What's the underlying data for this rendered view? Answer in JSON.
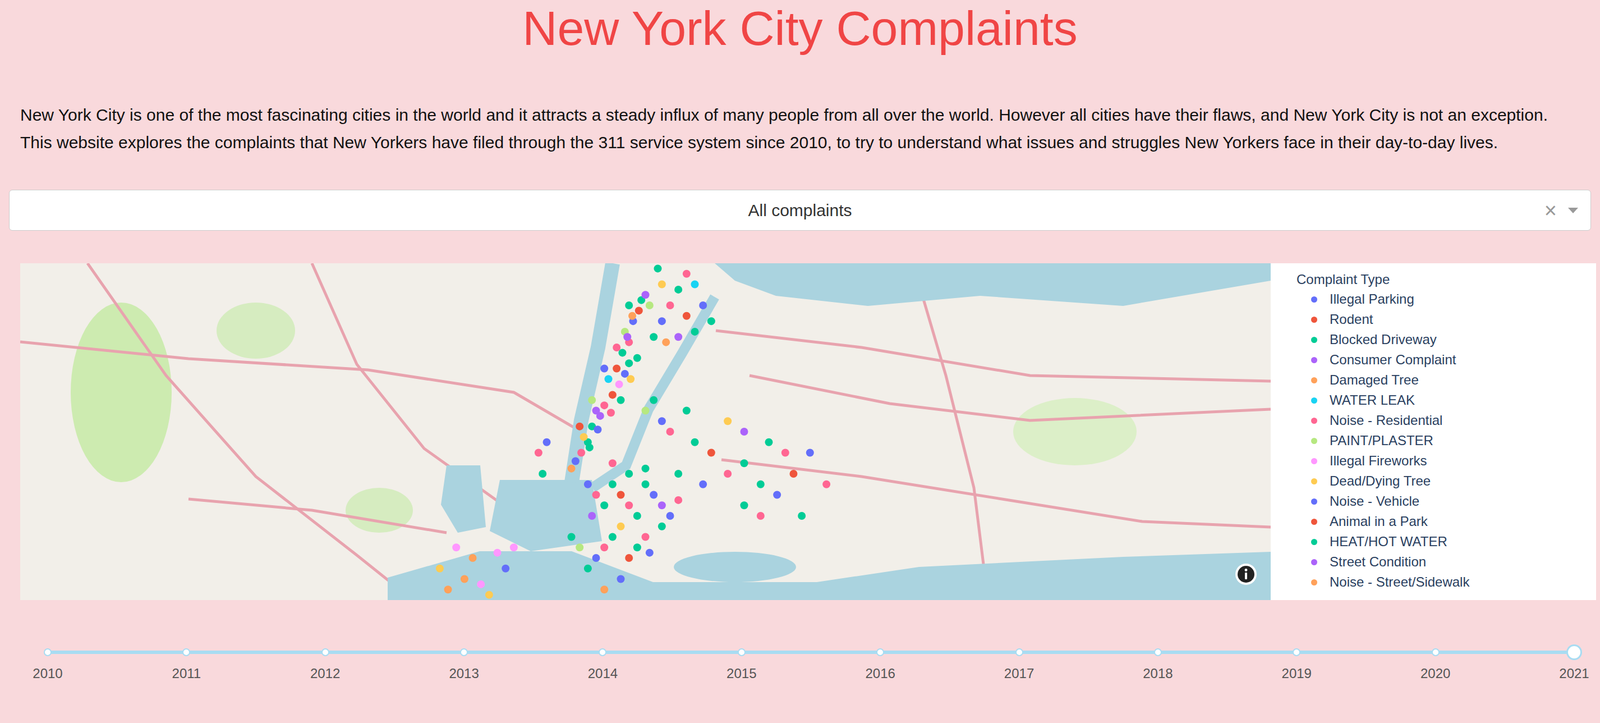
{
  "title": "New York City Complaints",
  "intro": [
    "New York City is one of the most fascinating cities in the world and it attracts a steady influx of many people from all over the world. However all cities have their flaws, and New York City is not an exception.",
    "This website explores the complaints that New Yorkers have filed through the 311 service system since 2010, to try to understand what issues and struggles New Yorkers face in their day-to-day lives."
  ],
  "dropdown": {
    "value": "All complaints",
    "clear": "×"
  },
  "legend": {
    "title": "Complaint Type",
    "items": [
      {
        "label": "Illegal Parking",
        "color": "#636efa"
      },
      {
        "label": "Rodent",
        "color": "#ef553b"
      },
      {
        "label": "Blocked Driveway",
        "color": "#00cc96"
      },
      {
        "label": "Consumer Complaint",
        "color": "#ab63fa"
      },
      {
        "label": "Damaged Tree",
        "color": "#ffa15a"
      },
      {
        "label": "WATER LEAK",
        "color": "#19d3f3"
      },
      {
        "label": "Noise - Residential",
        "color": "#ff6692"
      },
      {
        "label": "PAINT/PLASTER",
        "color": "#b6e880"
      },
      {
        "label": "Illegal Fireworks",
        "color": "#ff97ff"
      },
      {
        "label": "Dead/Dying Tree",
        "color": "#fecb52"
      },
      {
        "label": "Noise - Vehicle",
        "color": "#636efa"
      },
      {
        "label": "Animal in a Park",
        "color": "#ef553b"
      },
      {
        "label": "HEAT/HOT WATER",
        "color": "#00cc96"
      },
      {
        "label": "Street Condition",
        "color": "#ab63fa"
      },
      {
        "label": "Noise - Street/Sidewalk",
        "color": "#ffa15a"
      }
    ]
  },
  "map": {
    "points": [
      [
        -74.005,
        40.712,
        0
      ],
      [
        -73.998,
        40.72,
        6
      ],
      [
        -73.99,
        40.73,
        2
      ],
      [
        -73.985,
        40.745,
        12
      ],
      [
        -73.975,
        40.755,
        3
      ],
      [
        -73.97,
        40.765,
        6
      ],
      [
        -73.96,
        40.775,
        1
      ],
      [
        -73.952,
        40.785,
        8
      ],
      [
        -73.945,
        40.795,
        0
      ],
      [
        -73.94,
        40.805,
        12
      ],
      [
        -73.948,
        40.815,
        2
      ],
      [
        -73.94,
        40.825,
        6
      ],
      [
        -73.945,
        40.835,
        7
      ],
      [
        -73.935,
        40.845,
        10
      ],
      [
        -73.928,
        40.855,
        1
      ],
      [
        -73.925,
        40.865,
        12
      ],
      [
        -74.01,
        40.705,
        4
      ],
      [
        -73.995,
        40.735,
        9
      ],
      [
        -73.98,
        40.76,
        13
      ],
      [
        -73.965,
        40.79,
        5
      ],
      [
        -73.955,
        40.8,
        11
      ],
      [
        -73.942,
        40.83,
        3
      ],
      [
        -73.936,
        40.85,
        14
      ],
      [
        -73.988,
        40.725,
        12
      ],
      [
        -73.978,
        40.742,
        0
      ],
      [
        -73.962,
        40.758,
        6
      ],
      [
        -73.95,
        40.77,
        2
      ],
      [
        -73.938,
        40.79,
        9
      ],
      [
        -73.93,
        40.81,
        12
      ],
      [
        -74.0,
        40.745,
        1
      ],
      [
        -73.985,
        40.77,
        7
      ],
      [
        -73.97,
        40.8,
        0
      ],
      [
        -73.955,
        40.82,
        6
      ],
      [
        -73.94,
        40.86,
        2
      ],
      [
        -73.92,
        40.87,
        13
      ],
      [
        -73.91,
        40.83,
        12
      ],
      [
        -73.9,
        40.845,
        0
      ],
      [
        -73.89,
        40.86,
        6
      ],
      [
        -73.88,
        40.875,
        2
      ],
      [
        -73.87,
        40.85,
        1
      ],
      [
        -73.86,
        40.835,
        12
      ],
      [
        -73.9,
        40.88,
        9
      ],
      [
        -73.915,
        40.86,
        7
      ],
      [
        -73.88,
        40.83,
        3
      ],
      [
        -73.85,
        40.86,
        0
      ],
      [
        -73.87,
        40.89,
        6
      ],
      [
        -73.895,
        40.825,
        14
      ],
      [
        -73.84,
        40.845,
        2
      ],
      [
        -73.905,
        40.895,
        12
      ],
      [
        -73.86,
        40.88,
        5
      ],
      [
        -73.99,
        40.69,
        0
      ],
      [
        -73.98,
        40.68,
        6
      ],
      [
        -73.97,
        40.67,
        2
      ],
      [
        -73.96,
        40.69,
        12
      ],
      [
        -73.95,
        40.68,
        1
      ],
      [
        -73.94,
        40.67,
        6
      ],
      [
        -73.93,
        40.66,
        2
      ],
      [
        -73.92,
        40.69,
        12
      ],
      [
        -73.91,
        40.68,
        0
      ],
      [
        -73.9,
        40.67,
        3
      ],
      [
        -73.95,
        40.65,
        9
      ],
      [
        -73.96,
        40.64,
        2
      ],
      [
        -73.97,
        40.63,
        6
      ],
      [
        -73.98,
        40.62,
        0
      ],
      [
        -73.99,
        40.61,
        12
      ],
      [
        -74.0,
        40.63,
        7
      ],
      [
        -74.01,
        40.64,
        2
      ],
      [
        -73.94,
        40.62,
        1
      ],
      [
        -73.93,
        40.63,
        12
      ],
      [
        -73.92,
        40.64,
        6
      ],
      [
        -73.9,
        40.65,
        2
      ],
      [
        -73.89,
        40.66,
        10
      ],
      [
        -73.95,
        40.6,
        0
      ],
      [
        -73.97,
        40.59,
        4
      ],
      [
        -73.96,
        40.71,
        6
      ],
      [
        -73.94,
        40.7,
        12
      ],
      [
        -73.92,
        40.705,
        2
      ],
      [
        -73.985,
        40.66,
        13
      ],
      [
        -73.915,
        40.625,
        0
      ],
      [
        -73.88,
        40.675,
        6
      ],
      [
        -73.9,
        40.75,
        0
      ],
      [
        -73.89,
        40.74,
        6
      ],
      [
        -73.87,
        40.76,
        12
      ],
      [
        -73.86,
        40.73,
        2
      ],
      [
        -73.84,
        40.72,
        1
      ],
      [
        -73.82,
        40.7,
        6
      ],
      [
        -73.8,
        40.71,
        12
      ],
      [
        -73.78,
        40.69,
        2
      ],
      [
        -73.76,
        40.68,
        0
      ],
      [
        -73.82,
        40.75,
        9
      ],
      [
        -73.8,
        40.74,
        3
      ],
      [
        -73.77,
        40.73,
        12
      ],
      [
        -73.75,
        40.72,
        6
      ],
      [
        -73.88,
        40.7,
        2
      ],
      [
        -73.85,
        40.69,
        0
      ],
      [
        -73.8,
        40.67,
        12
      ],
      [
        -73.78,
        40.66,
        6
      ],
      [
        -73.92,
        40.76,
        7
      ],
      [
        -73.91,
        40.77,
        2
      ],
      [
        -73.74,
        40.7,
        1
      ],
      [
        -74.15,
        40.63,
        8
      ],
      [
        -74.13,
        40.62,
        4
      ],
      [
        -74.1,
        40.625,
        8
      ],
      [
        -74.17,
        40.61,
        9
      ],
      [
        -74.14,
        40.6,
        4
      ],
      [
        -74.12,
        40.595,
        8
      ],
      [
        -74.09,
        40.61,
        0
      ],
      [
        -74.16,
        40.59,
        4
      ],
      [
        -74.11,
        40.585,
        9
      ],
      [
        -74.08,
        40.63,
        8
      ],
      [
        -73.72,
        40.72,
        0
      ],
      [
        -73.7,
        40.69,
        6
      ],
      [
        -73.73,
        40.66,
        2
      ],
      [
        -74.04,
        40.73,
        0
      ],
      [
        -74.05,
        40.72,
        6
      ],
      [
        -74.045,
        40.7,
        12
      ]
    ]
  },
  "slider": {
    "marks": [
      {
        "label": "2010",
        "selected": false
      },
      {
        "label": "2011",
        "selected": false
      },
      {
        "label": "2012",
        "selected": false
      },
      {
        "label": "2013",
        "selected": false
      },
      {
        "label": "2014",
        "selected": false
      },
      {
        "label": "2015",
        "selected": false
      },
      {
        "label": "2016",
        "selected": false
      },
      {
        "label": "2017",
        "selected": false
      },
      {
        "label": "2018",
        "selected": false
      },
      {
        "label": "2019",
        "selected": false
      },
      {
        "label": "2020",
        "selected": false
      },
      {
        "label": "2021",
        "selected": true
      }
    ]
  }
}
